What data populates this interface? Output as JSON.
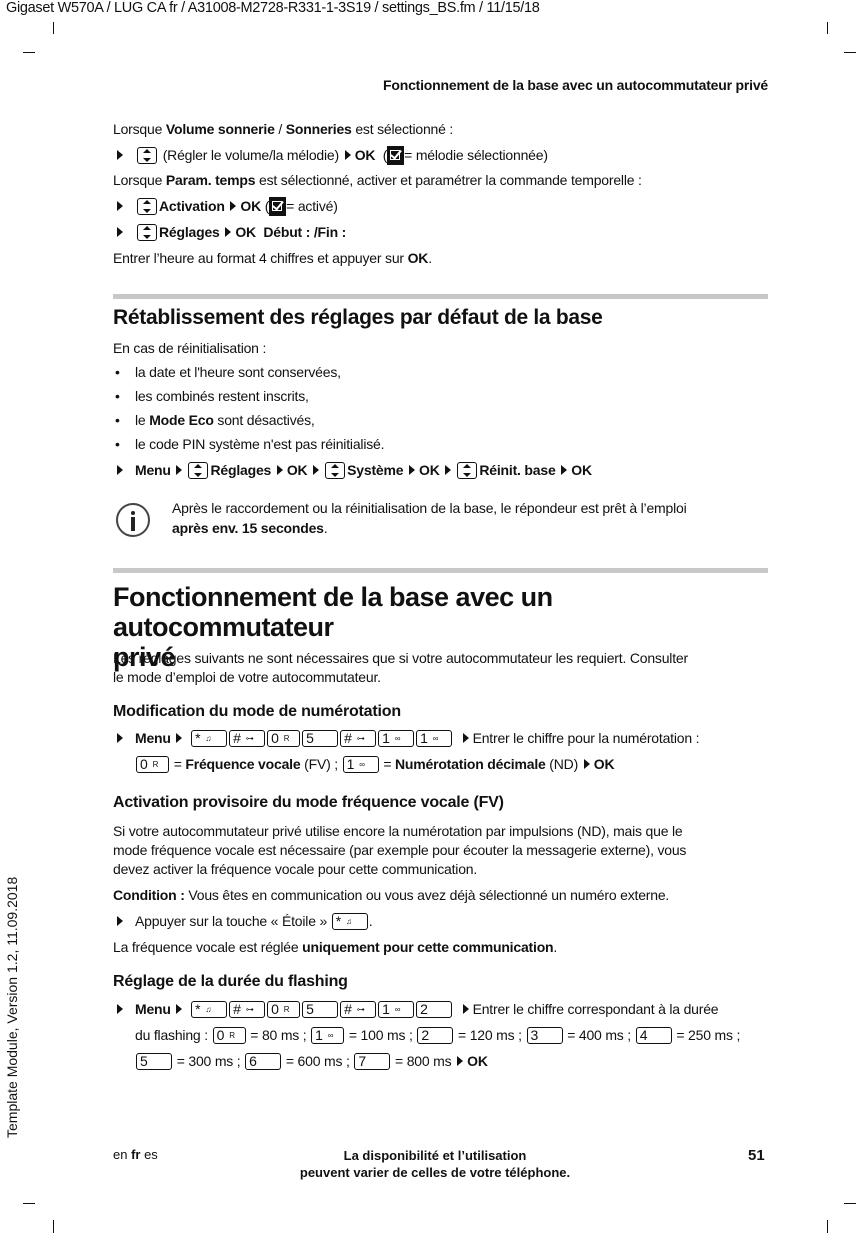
{
  "header": {
    "file_path": "Gigaset W570A / LUG CA fr / A31008-M2728-R331-1-3S19 / settings_BS.fm / 11/15/18",
    "running_title": "Fonctionnement de la base avec un autocommutateur privé"
  },
  "side_label": "Template Module, Version 1.2, 11.09.2018",
  "intro": {
    "line1_pre": "Lorsque ",
    "line1_b1": "Volume sonnerie",
    "line1_mid": " / ",
    "line1_b2": "Sonneries",
    "line1_post": " est sélectionné :",
    "step1_text": "(Régler le volume/la mélodie)",
    "step1_ok": "OK",
    "step1_open": "(",
    "step1_note": "= mélodie sélectionnée)",
    "line2_pre": "Lorsque ",
    "line2_b": "Param. temps",
    "line2_post": " est sélectionné, activer et paramétrer la commande temporelle :",
    "step2_b": "Activation",
    "step2_ok": "OK",
    "step2_open": "(",
    "step2_note": "= activé)",
    "step3_b": "Réglages",
    "step3_ok": "OK",
    "step3_extra": "Début : /Fin :",
    "line3_pre": "Entrer l’heure au format 4 chiffres et appuyer sur ",
    "line3_b": "OK",
    "line3_post": "."
  },
  "reset": {
    "title": "Rétablissement des réglages par défaut de la base",
    "lead": "En cas de réinitialisation :",
    "bullets": [
      {
        "pre": "la date et l'heure sont conservées,",
        "b": "",
        "post": ""
      },
      {
        "pre": "les combinés restent inscrits,",
        "b": "",
        "post": ""
      },
      {
        "pre": "le ",
        "b": "Mode Eco",
        "post": " sont désactivés,"
      },
      {
        "pre": "le code PIN système n'est pas réinitialisé.",
        "b": "",
        "post": ""
      }
    ],
    "path": [
      "Menu",
      "Réglages",
      "OK",
      "Système",
      "OK",
      "Réinit. base",
      "OK"
    ],
    "info_line1": "Après le raccordement ou la réinitialisation de la base, le répondeur est prêt à l’emploi",
    "info_line2_b": "après env. 15 secondes",
    "info_line2_post": "."
  },
  "pbx": {
    "title_line1": "Fonctionnement de la base avec un autocommutateur",
    "title_line2": "privé",
    "intro_line1": "Les réglages suivants ne sont nécessaires que si votre autocommutateur les requiert. Consulter",
    "intro_line2": "le mode d’emploi de votre autocommutateur.",
    "dialmode": {
      "title": "Modification du mode de numérotation",
      "menu": "Menu",
      "keys": [
        {
          "main": "*",
          "sub": "♫"
        },
        {
          "main": "#",
          "sub": "⊶"
        },
        {
          "main": "0",
          "sub": "R"
        },
        {
          "main": "5",
          "sub": ""
        },
        {
          "main": "#",
          "sub": "⊶"
        },
        {
          "main": "1",
          "sub": "∞"
        },
        {
          "main": "1",
          "sub": "∞"
        }
      ],
      "after": "Entrer le chiffre pour la numérotation :",
      "opt1_key": "0",
      "opt1_key_sub": "R",
      "opt1_eq": " = ",
      "opt1_b": "Fréquence vocale",
      "opt1_post": " (FV) ; ",
      "opt2_key": "1",
      "opt2_key_sub": "∞",
      "opt2_eq": " = ",
      "opt2_b": "Numérotation décimale",
      "opt2_post": " (ND)",
      "ok": "OK"
    },
    "tone": {
      "title": "Activation provisoire du mode fréquence vocale (FV)",
      "para_l1": "Si votre autocommutateur privé utilise encore la numérotation par impulsions (ND), mais que le",
      "para_l2": "mode fréquence vocale est nécessaire (par exemple pour écouter la messagerie externe), vous",
      "para_l3": "devez activer la fréquence vocale pour cette communication.",
      "cond_b": "Condition :",
      "cond_text": " Vous êtes en communication ou vous avez déjà sélectionné un numéro externe.",
      "step": "Appuyer sur la touche « Étoile »",
      "step_key": "*",
      "step_key_sub": "♫",
      "step_post": ".",
      "result_pre": "La fréquence vocale est réglée ",
      "result_b": "uniquement pour cette communication",
      "result_post": "."
    },
    "flash": {
      "title": "Réglage de la durée du flashing",
      "menu": "Menu",
      "keys": [
        {
          "main": "*",
          "sub": "♫"
        },
        {
          "main": "#",
          "sub": "⊶"
        },
        {
          "main": "0",
          "sub": "R"
        },
        {
          "main": "5",
          "sub": ""
        },
        {
          "main": "#",
          "sub": "⊶"
        },
        {
          "main": "1",
          "sub": "∞"
        },
        {
          "main": "2",
          "sub": ""
        }
      ],
      "after": "Entrer le chiffre correspondant à la durée",
      "lead": "du flashing : ",
      "options": [
        {
          "key": "0",
          "sub": "R",
          "value": "= 80 ms ;"
        },
        {
          "key": "1",
          "sub": "∞",
          "value": "= 100 ms ;"
        },
        {
          "key": "2",
          "sub": "",
          "value": "= 120 ms ;"
        },
        {
          "key": "3",
          "sub": "",
          "value": "= 400 ms ;"
        },
        {
          "key": "4",
          "sub": "",
          "value": "= 250 ms ;"
        },
        {
          "key": "5",
          "sub": "",
          "value": "= 300 ms ;"
        },
        {
          "key": "6",
          "sub": "",
          "value": "= 600 ms ;"
        },
        {
          "key": "7",
          "sub": "",
          "value": "= 800 ms"
        }
      ],
      "ok": "OK"
    }
  },
  "footer": {
    "langs_pre": "en ",
    "langs_b": "fr",
    "langs_post": " es",
    "note_line1": "La disponibilité et l’utilisation",
    "note_line2": "peuvent varier de celles de votre téléphone.",
    "page_number": "51"
  }
}
